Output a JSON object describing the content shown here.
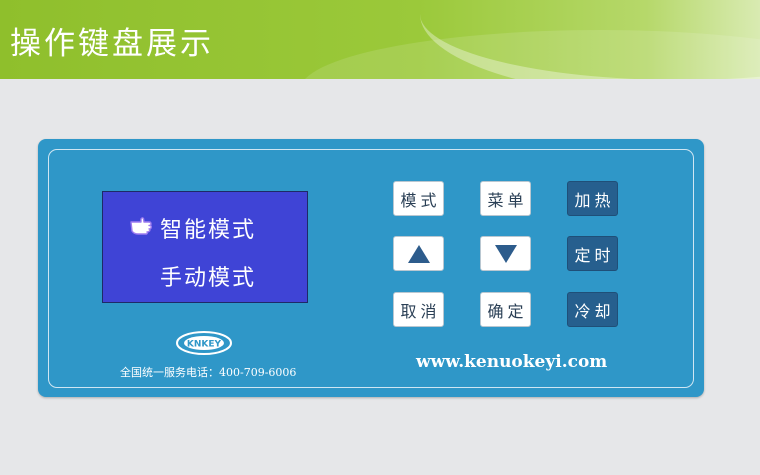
{
  "banner": {
    "title": "操作键盘展示"
  },
  "lcd": {
    "line1": "智能模式",
    "line2": "手动模式",
    "pointer_icon": "pointing-hand-icon"
  },
  "buttons": {
    "mode": "模式",
    "menu": "菜单",
    "heat": "加热",
    "timer": "定时",
    "cancel": "取消",
    "confirm": "确定",
    "cool": "冷却",
    "up_icon": "up-arrow-icon",
    "down_icon": "down-arrow-icon"
  },
  "footer": {
    "logo_text": "KNKEY",
    "hotline": "全国统一服务电话：400-709-6006",
    "website": "www.kenuokeyi.com"
  },
  "colors": {
    "banner_green": "#9bc93a",
    "panel_blue": "#2f97c8",
    "lcd_blue": "#3f44d6",
    "dark_button": "#265f8e"
  }
}
